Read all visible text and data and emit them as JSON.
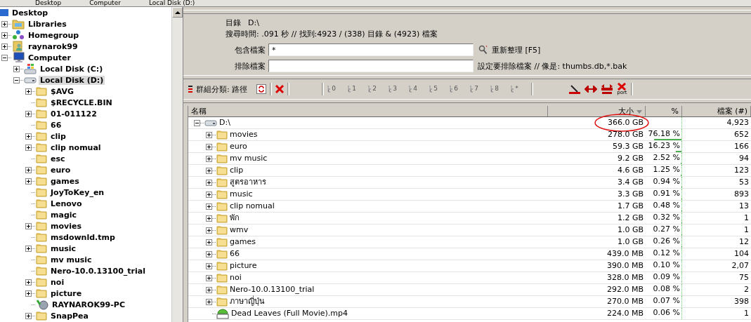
{
  "breadcrumb": [
    "Desktop",
    "Computer",
    "Local Disk (D:)"
  ],
  "tree": {
    "label": "Desktop",
    "kind": "desktop",
    "selected": false,
    "children": [
      {
        "label": "Libraries",
        "kind": "libraries",
        "expandable": true,
        "expanded": false,
        "selected": false
      },
      {
        "label": "Homegroup",
        "kind": "homegroup",
        "expandable": true,
        "expanded": false,
        "selected": false
      },
      {
        "label": "raynarok99",
        "kind": "user",
        "expandable": true,
        "expanded": false,
        "selected": false
      },
      {
        "label": "Computer",
        "kind": "computer",
        "expandable": true,
        "expanded": true,
        "selected": false,
        "children": [
          {
            "label": "Local Disk (C:)",
            "kind": "windows-drive",
            "expandable": true,
            "expanded": false,
            "selected": false
          },
          {
            "label": "Local Disk (D:)",
            "kind": "drive",
            "expandable": true,
            "expanded": true,
            "selected": true,
            "children": [
              {
                "label": "$AVG",
                "kind": "folder",
                "expandable": true,
                "expanded": false,
                "selected": false
              },
              {
                "label": "$RECYCLE.BIN",
                "kind": "folder",
                "expandable": false,
                "expanded": false,
                "selected": false
              },
              {
                "label": "01-011122",
                "kind": "folder",
                "expandable": true,
                "expanded": false,
                "selected": false
              },
              {
                "label": "66",
                "kind": "folder",
                "expandable": false,
                "expanded": false,
                "selected": false
              },
              {
                "label": "clip",
                "kind": "folder",
                "expandable": true,
                "expanded": false,
                "selected": false
              },
              {
                "label": "clip nomual",
                "kind": "folder",
                "expandable": true,
                "expanded": false,
                "selected": false
              },
              {
                "label": "esc",
                "kind": "folder",
                "expandable": false,
                "expanded": false,
                "selected": false
              },
              {
                "label": "euro",
                "kind": "folder",
                "expandable": true,
                "expanded": false,
                "selected": false
              },
              {
                "label": "games",
                "kind": "folder",
                "expandable": true,
                "expanded": false,
                "selected": false
              },
              {
                "label": "JoyToKey_en",
                "kind": "folder",
                "expandable": false,
                "expanded": false,
                "selected": false
              },
              {
                "label": "Lenovo",
                "kind": "folder",
                "expandable": false,
                "expanded": false,
                "selected": false
              },
              {
                "label": "magic",
                "kind": "folder",
                "expandable": false,
                "expanded": false,
                "selected": false
              },
              {
                "label": "movies",
                "kind": "folder",
                "expandable": true,
                "expanded": false,
                "selected": false
              },
              {
                "label": "msdownld.tmp",
                "kind": "folder",
                "expandable": false,
                "expanded": false,
                "selected": false
              },
              {
                "label": "music",
                "kind": "folder",
                "expandable": true,
                "expanded": false,
                "selected": false
              },
              {
                "label": "mv music",
                "kind": "folder",
                "expandable": false,
                "expanded": false,
                "selected": false
              },
              {
                "label": "Nero-10.0.13100_trial",
                "kind": "folder",
                "expandable": false,
                "expanded": false,
                "selected": false
              },
              {
                "label": "noi",
                "kind": "folder",
                "expandable": true,
                "expanded": false,
                "selected": false
              },
              {
                "label": "picture",
                "kind": "folder",
                "expandable": true,
                "expanded": false,
                "selected": false
              },
              {
                "label": "RAYNAROK99-PC",
                "kind": "network",
                "expandable": false,
                "expanded": false,
                "selected": false
              },
              {
                "label": "SnapPea",
                "kind": "folder",
                "expandable": true,
                "expanded": false,
                "selected": false
              }
            ]
          }
        ]
      }
    ]
  },
  "info": {
    "directory_label": "目錄",
    "directory": "D:\\",
    "summary": "搜尋時間: .091 秒 // 找到:4923 / (338) 目錄 & (4923) 檔案"
  },
  "include": {
    "label": "包含檔案",
    "value": "*",
    "action": "重新整理 [F5]"
  },
  "exclude": {
    "label": "排除檔案",
    "hint": "設定要排除檔案 // 像是: thumbs.db,*.bak"
  },
  "toolbar": {
    "group_label": "群組分類: 路徑",
    "levels": [
      "0",
      "1",
      "2",
      "3",
      "4",
      "5",
      "6",
      "7",
      "8",
      "*"
    ],
    "export_label": "port"
  },
  "table": {
    "columns": [
      {
        "label": "名稱",
        "sorted": false
      },
      {
        "label": "大小",
        "sorted": true
      },
      {
        "label": "%",
        "sorted": false
      },
      {
        "label": "檔案 (#)",
        "sorted": false
      }
    ],
    "rows": [
      {
        "name": "D:\\",
        "kind": "drive",
        "expanded": true,
        "size": "366.0 GB",
        "files": "4,923",
        "circled": true
      },
      {
        "name": "movies",
        "kind": "folder",
        "expanded": false,
        "size": "278.0 GB",
        "percent": "76.18 %",
        "level": 0.7618,
        "files": "652",
        "circled": false
      },
      {
        "name": "euro",
        "kind": "folder",
        "expanded": false,
        "size": "59.3 GB",
        "percent": "16.23 %",
        "level": 0.1623,
        "files": "166",
        "circled": false
      },
      {
        "name": "mv music",
        "kind": "folder",
        "expanded": false,
        "size": "9.2 GB",
        "percent": "2.52 %",
        "level": 0.0252,
        "files": "94",
        "circled": false
      },
      {
        "name": "clip",
        "kind": "folder",
        "expanded": false,
        "size": "4.6 GB",
        "percent": "1.25 %",
        "level": 0.0125,
        "files": "123",
        "circled": false
      },
      {
        "name": "สูตรอาหาร",
        "kind": "folder",
        "expanded": false,
        "size": "3.4 GB",
        "percent": "0.94 %",
        "level": 0.0094,
        "files": "53",
        "circled": false
      },
      {
        "name": "music",
        "kind": "folder",
        "expanded": false,
        "size": "3.3 GB",
        "percent": "0.91 %",
        "level": 0.0091,
        "files": "893",
        "circled": false
      },
      {
        "name": "clip nomual",
        "kind": "folder",
        "expanded": false,
        "size": "1.7 GB",
        "percent": "0.48 %",
        "level": 0.0048,
        "files": "13",
        "circled": false
      },
      {
        "name": "พัก",
        "kind": "folder",
        "expanded": false,
        "size": "1.2 GB",
        "percent": "0.32 %",
        "level": 0.0032,
        "files": "1",
        "circled": false
      },
      {
        "name": "wmv",
        "kind": "folder",
        "expanded": false,
        "size": "1.0 GB",
        "percent": "0.27 %",
        "level": 0.0027,
        "files": "1",
        "circled": false
      },
      {
        "name": "games",
        "kind": "folder",
        "expanded": false,
        "size": "1.0 GB",
        "percent": "0.26 %",
        "level": 0.0026,
        "files": "12",
        "circled": false
      },
      {
        "name": "66",
        "kind": "folder",
        "expanded": false,
        "size": "439.0 MB",
        "percent": "0.12 %",
        "level": 0.0012,
        "files": "104",
        "circled": false
      },
      {
        "name": "picture",
        "kind": "folder",
        "expanded": false,
        "size": "390.0 MB",
        "percent": "0.10 %",
        "level": 0.001,
        "files": "2,07",
        "circled": false
      },
      {
        "name": "noi",
        "kind": "folder",
        "expanded": false,
        "size": "328.0 MB",
        "percent": "0.09 %",
        "level": 0.0009,
        "files": "75",
        "circled": false
      },
      {
        "name": "Nero-10.0.13100_trial",
        "kind": "folder",
        "expanded": false,
        "size": "292.0 MB",
        "percent": "0.08 %",
        "level": 0.0008,
        "files": "2",
        "circled": false
      },
      {
        "name": "ภาษาญี่ปุ่น",
        "kind": "folder",
        "expanded": false,
        "size": "270.0 MB",
        "percent": "0.07 %",
        "level": 0.0007,
        "files": "398",
        "circled": false
      },
      {
        "name": "Dead Leaves (Full Movie).mp4",
        "kind": "video",
        "size": "224.0 MB",
        "percent": "0.06 %",
        "level": 0.0006,
        "files": "1",
        "circled": false
      }
    ]
  }
}
